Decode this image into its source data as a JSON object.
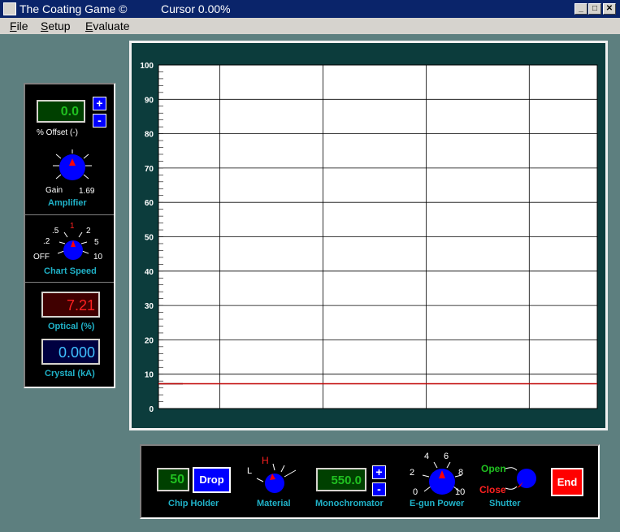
{
  "window": {
    "title": "The Coating Game ©",
    "cursor_label": "Cursor 0.00%",
    "minimize": "_",
    "maximize": "□",
    "close": "✕"
  },
  "menu": {
    "items": [
      "File",
      "Setup",
      "Evaluate"
    ],
    "hotkeys": [
      "F",
      "S",
      "E"
    ],
    "rests": [
      "ile",
      "etup",
      "valuate"
    ]
  },
  "left_panel": {
    "offset_value": "0.0",
    "offset_label": "% Offset (-)",
    "plus": "+",
    "minus": "-",
    "gain_label": "Gain",
    "gain_value": "1.69",
    "amplifier_label": "Amplifier",
    "speed_ticks": {
      "off": "OFF",
      "p2": ".2",
      "p5": ".5",
      "one": "1",
      "two": "2",
      "five": "5",
      "ten": "10"
    },
    "chart_speed_label": "Chart Speed",
    "optical_value": "7.21",
    "optical_label": "Optical (%)",
    "crystal_value": "0.000",
    "crystal_label": "Crystal (kA)"
  },
  "bottom_panel": {
    "chip_value": "50",
    "drop_label": "Drop",
    "chip_holder_label": "Chip Holder",
    "material_low": "L",
    "material_high": "H",
    "material_label": "Material",
    "mono_value": "550.0",
    "mono_plus": "+",
    "mono_minus": "-",
    "monochromator_label": "Monochromator",
    "egun_ticks": {
      "t0": "0",
      "t2": "2",
      "t4": "4",
      "t6": "6",
      "t8": "8",
      "t10": "10"
    },
    "egun_label": "E-gun Power",
    "shutter_open": "Open",
    "shutter_close": "Close",
    "shutter_label": "Shutter",
    "end_label": "End"
  },
  "colors": {
    "accent_blue": "#0000ff",
    "lcd_green": "#20c020",
    "lcd_red": "#ff2020",
    "lcd_cyan": "#40c0ff",
    "label_cyan": "#20b2c8",
    "trace_red": "#c00000"
  },
  "chart_data": {
    "type": "line",
    "ylim": [
      0,
      100
    ],
    "yticks": [
      "0",
      "10",
      "20",
      "30",
      "40",
      "50",
      "60",
      "70",
      "80",
      "90",
      "100"
    ],
    "xlim": [
      0,
      100
    ],
    "grid": true,
    "series": [
      {
        "x": [
          0,
          100
        ],
        "y": [
          7.21,
          7.21
        ]
      }
    ]
  }
}
